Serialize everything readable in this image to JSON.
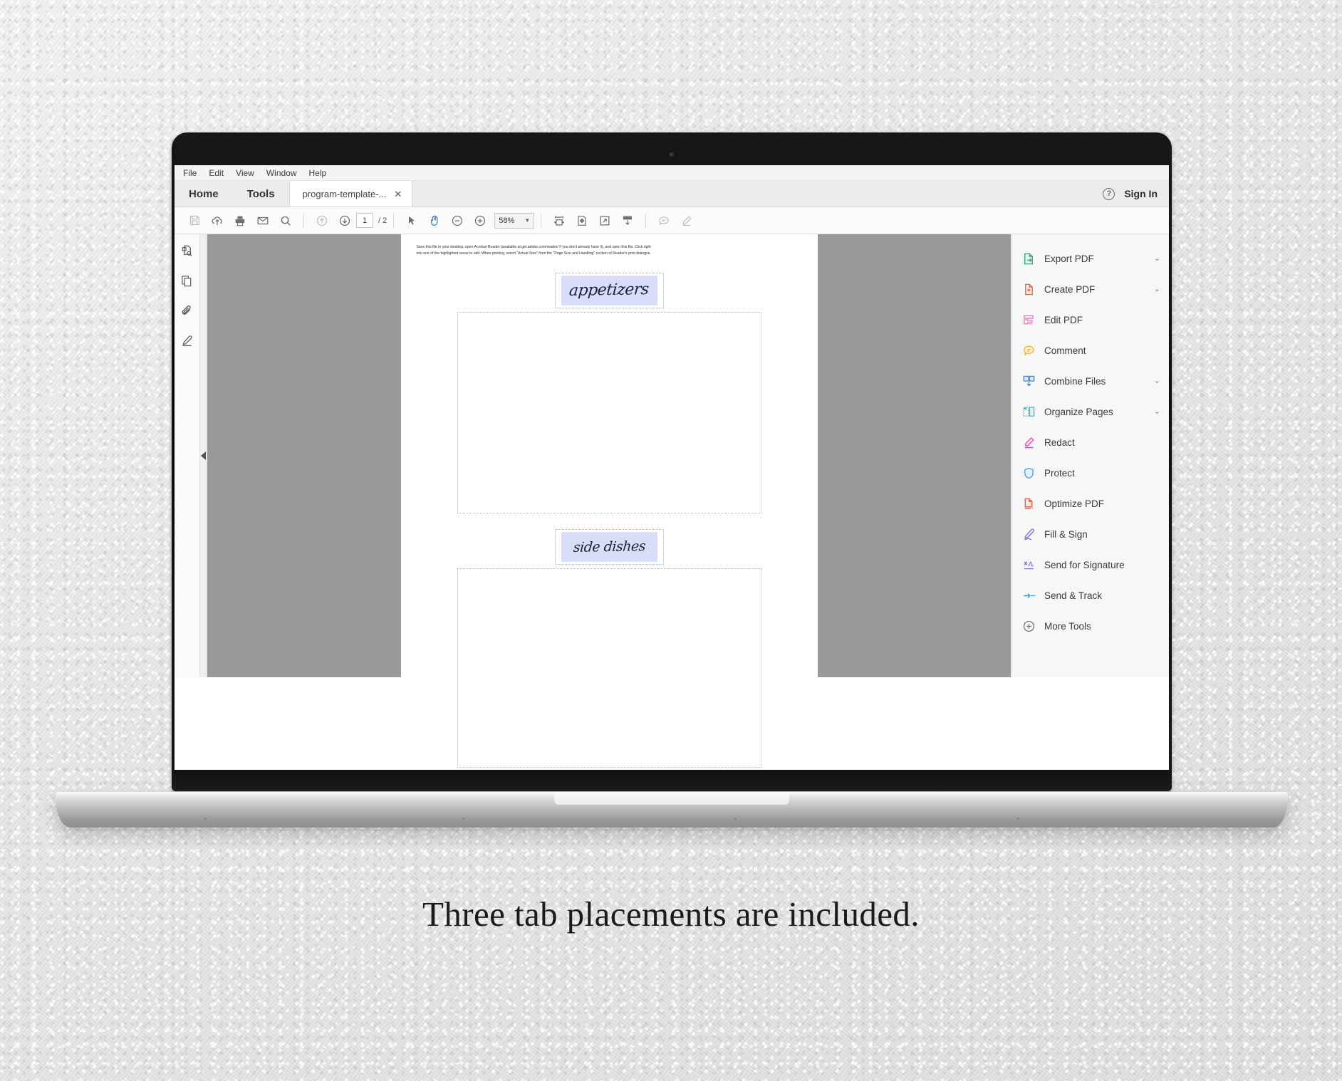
{
  "app": {
    "menu": [
      "File",
      "Edit",
      "View",
      "Window",
      "Help"
    ],
    "tabs": {
      "home_label": "Home",
      "tools_label": "Tools",
      "document_tab": "program-template-...",
      "close_glyph": "✕"
    },
    "account": {
      "help_icon": "help-icon",
      "sign_in_label": "Sign In"
    },
    "toolbar": {
      "save_icon": "save-icon",
      "upload_icon": "cloud-upload-icon",
      "print_icon": "print-icon",
      "email_icon": "email-icon",
      "search_icon": "search-icon",
      "prev_page_icon": "previous-page-icon",
      "next_page_icon": "next-page-icon",
      "page_number": "1",
      "page_total": "/ 2",
      "select_icon": "select-cursor-icon",
      "hand_icon": "hand-tool-icon",
      "zoom_out_icon": "zoom-out-icon",
      "zoom_in_icon": "zoom-in-icon",
      "zoom_level": "58%",
      "zoom_caret": "▼",
      "fit_width_icon": "fit-width-icon",
      "fit_page_icon": "fit-page-icon",
      "fullscreen_icon": "fullscreen-icon",
      "scroll_mode_icon": "scroll-mode-icon",
      "comment_icon": "comment-icon",
      "highlight_icon": "highlight-icon"
    },
    "left_rail": [
      {
        "name": "page-thumbnails-icon"
      },
      {
        "name": "pages-panel-icon"
      },
      {
        "name": "attachments-icon"
      },
      {
        "name": "signatures-icon"
      }
    ],
    "collapse_panel": "collapse-left-panel-arrow"
  },
  "document": {
    "instruction_line_1": "Save this file to your desktop, open Acrobat Reader (available at get.adobe.com/reader/ if you don't already have it), and open this file.  Click right",
    "instruction_line_2": "into one of the highlighted areas to edit. When printing, select \"Actual Size\" from the \"Page Size and Handling\" section of Reader's print dialogue.",
    "section_1_label": "appetizers",
    "section_2_label": "side dishes"
  },
  "tools_panel": {
    "items": [
      {
        "label": "Export PDF",
        "icon": "export-pdf-icon",
        "caret": "∨",
        "color": "#3aa17e"
      },
      {
        "label": "Create PDF",
        "icon": "create-pdf-icon",
        "caret": "∨",
        "color": "#e8664a"
      },
      {
        "label": "Edit PDF",
        "icon": "edit-pdf-icon",
        "caret": "",
        "color": "#e57ec0"
      },
      {
        "label": "Comment",
        "icon": "comment-tool-icon",
        "caret": "",
        "color": "#f0b43c"
      },
      {
        "label": "Combine Files",
        "icon": "combine-files-icon",
        "caret": "∨",
        "color": "#3f7fd0"
      },
      {
        "label": "Organize Pages",
        "icon": "organize-pages-icon",
        "caret": "∨",
        "color": "#3fb9c9"
      },
      {
        "label": "Redact",
        "icon": "redact-icon",
        "caret": "",
        "color": "#e158b5"
      },
      {
        "label": "Protect",
        "icon": "protect-icon",
        "caret": "",
        "color": "#4aa3e0"
      },
      {
        "label": "Optimize PDF",
        "icon": "optimize-pdf-icon",
        "caret": "",
        "color": "#e05a3c"
      },
      {
        "label": "Fill & Sign",
        "icon": "fill-and-sign-icon",
        "caret": "",
        "color": "#7b79d6"
      },
      {
        "label": "Send for Signature",
        "icon": "send-for-signature-icon",
        "caret": "",
        "color": "#8e7de0"
      },
      {
        "label": "Send & Track",
        "icon": "send-and-track-icon",
        "caret": "",
        "color": "#2fa8c4"
      },
      {
        "label": "More Tools",
        "icon": "more-tools-icon",
        "caret": "",
        "color": "#6e6e6e"
      }
    ]
  },
  "caption": {
    "text": "Three tab placements are included."
  },
  "colors": {
    "workspace_gray": "#999999",
    "panel_bg": "#f7f7f7",
    "form_field_highlight": "#d9def8",
    "accent_blue": "#2d7fd3"
  }
}
